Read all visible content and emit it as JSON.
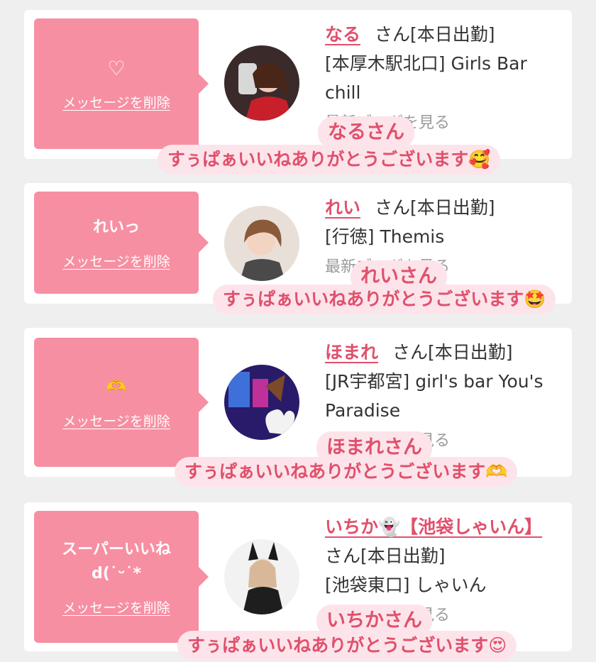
{
  "cards": [
    {
      "message": "♡",
      "delete_label": "メッセージを削除",
      "name": "なる",
      "suffix": "さん[本日出勤]",
      "shop": "[本厚木駅北口] Girls Bar chill",
      "more": "最新ブログを見る",
      "overlay_name": "なるさん",
      "overlay_thanks": "すぅぱぁいいねありがとうございます🥰"
    },
    {
      "message": "れいっ",
      "delete_label": "メッセージを削除",
      "name": "れい",
      "suffix": "さん[本日出勤]",
      "shop": "[行徳] Themis",
      "more": "最新ブログを見る",
      "overlay_name": "れいさん",
      "overlay_thanks": "すぅぱぁいいねありがとうございます🤩"
    },
    {
      "message": "🫶",
      "delete_label": "メッセージを削除",
      "name": "ほまれ",
      "suffix": "さん[本日出勤]",
      "shop": "[JR宇都宮] girl's bar You's Paradise",
      "more": "最新ブログを見る",
      "overlay_name": "ほまれさん",
      "overlay_thanks": "すぅぱぁいいねありがとうございます🫶"
    },
    {
      "message": "スーパーいいね d(˙ᵕ˙*",
      "delete_label": "メッセージを削除",
      "name": "いちか👻【池袋しゃいん】",
      "suffix": "さん[本日出勤]",
      "shop": "[池袋東口] しゃいん",
      "more": "最新ブログを見る",
      "overlay_name": "いちかさん",
      "overlay_thanks": "すぅぱぁいいねありがとうございます😍"
    }
  ],
  "colors": {
    "accent": "#e0506c",
    "bubble": "#f78fa3",
    "overlay_bg": "#fce4ea"
  }
}
